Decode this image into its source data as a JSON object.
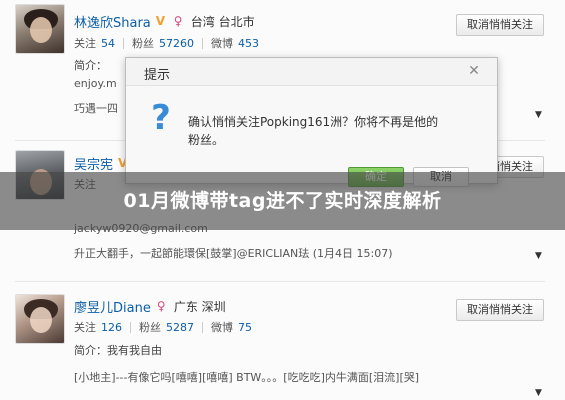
{
  "users": [
    {
      "name": "林逸欣Shara",
      "verified_badge": "V",
      "gender_icon": "female-icon",
      "location": "台湾 台北市",
      "follow_label": "关注",
      "follow_count": "54",
      "fans_label": "粉丝",
      "fans_count": "57260",
      "weibo_label": "微博",
      "weibo_count": "453",
      "intro": "简介：",
      "email": "enjoy.m",
      "post": "巧遇一四"
    },
    {
      "name": "吴宗宪",
      "verified_badge": "V",
      "follow_label": "关注",
      "email": "jackyw0920@gmail.com",
      "post": "升正大翻手，一起節能環保[鼓掌]@ERICLIAN珐 (1月4日 15:07)"
    },
    {
      "name": "廖昱儿Diane",
      "gender_icon": "female-icon",
      "location": "广东 深圳",
      "follow_label": "关注",
      "follow_count": "126",
      "fans_label": "粉丝",
      "fans_count": "5287",
      "weibo_label": "微博",
      "weibo_count": "75",
      "intro": "简介：我有我自由",
      "post": "[小地主]---有像它吗[嘻嘻][嘻嘻] BTW。。。[吃吃吃]内牛满面[泪流][哭]"
    }
  ],
  "buttons": {
    "unfollow": "取消悄悄关注"
  },
  "dialog": {
    "title": "提示",
    "message_line1": "确认悄悄关注Popking161洲？你将不再是他的",
    "message_line2": "粉丝。",
    "ok_label": "确定",
    "cancel_label": "取消"
  },
  "banner": {
    "text": "01月微博带tag进不了实时深度解析"
  }
}
